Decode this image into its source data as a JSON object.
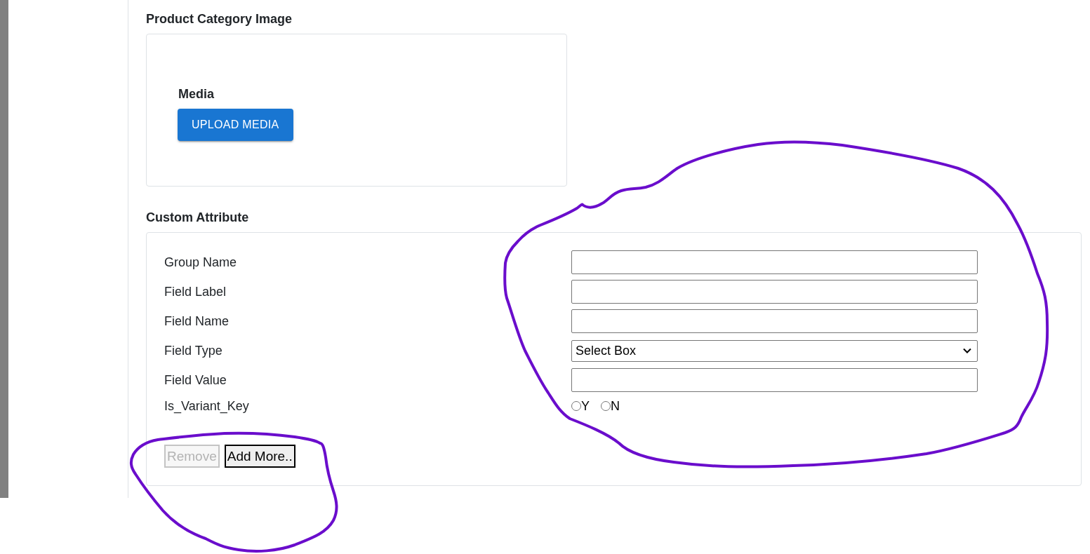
{
  "product_category_image": {
    "title": "Product Category Image",
    "media_label": "Media",
    "upload_button": "UPLOAD MEDIA"
  },
  "custom_attribute": {
    "title": "Custom Attribute",
    "fields": [
      {
        "label": "Group Name",
        "kind": "text"
      },
      {
        "label": "Field Label",
        "kind": "text"
      },
      {
        "label": "Field Name",
        "kind": "text"
      },
      {
        "label": "Field Type",
        "kind": "select",
        "value": "Select Box"
      },
      {
        "label": "Field Value",
        "kind": "text"
      },
      {
        "label": "Is_Variant_Key",
        "kind": "radio",
        "options": [
          {
            "label": "Y",
            "selected": false
          },
          {
            "label": "N",
            "selected": false
          }
        ]
      }
    ],
    "buttons": [
      {
        "label": "Remove",
        "disabled": true
      },
      {
        "label": "Add More..",
        "disabled": false
      }
    ]
  }
}
